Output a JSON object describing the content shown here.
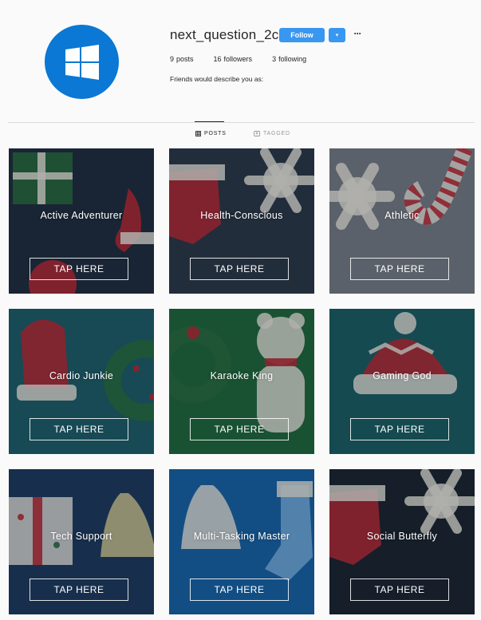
{
  "profile": {
    "username": "next_question_2c",
    "follow_label": "Follow",
    "dropdown_glyph": "▾",
    "more_glyph": "···",
    "stats": [
      {
        "count": "9",
        "label": "posts"
      },
      {
        "count": "16",
        "label": "followers"
      },
      {
        "count": "3",
        "label": "following"
      }
    ],
    "bio": "Friends would describe you as:",
    "avatar_icon": "windows-logo-icon",
    "brand_color": "#0a78d4",
    "button_color": "#3897f0"
  },
  "tabs": [
    {
      "label": "POSTS",
      "icon": "grid-icon",
      "active": true
    },
    {
      "label": "TAGGED",
      "icon": "tag-icon",
      "active": false
    }
  ],
  "grid": {
    "button_label": "TAP HERE",
    "tiles": [
      {
        "label": "Active Adventurer",
        "theme": "#1f2c3b",
        "art": "present-stocking"
      },
      {
        "label": "Health-Conscious",
        "theme": "#2b3644",
        "art": "stocking-snowflake"
      },
      {
        "label": "Athletic",
        "theme": "#7b7f86",
        "art": "snowflake-candycane"
      },
      {
        "label": "Cardio Junkie",
        "theme": "#1c5f68",
        "art": "mitten-wreath"
      },
      {
        "label": "Karaoke King",
        "theme": "#1f6a3a",
        "art": "wreath-bear"
      },
      {
        "label": "Gaming God",
        "theme": "#1a5f63",
        "art": "beanie"
      },
      {
        "label": "Tech Support",
        "theme": "#1c3a5c",
        "art": "gift-bell"
      },
      {
        "label": "Multi-Tasking Master",
        "theme": "#1565a8",
        "art": "bell-stocking"
      },
      {
        "label": "Social Butterfly",
        "theme": "#1a222c",
        "art": "stocking-snowflake"
      }
    ]
  }
}
